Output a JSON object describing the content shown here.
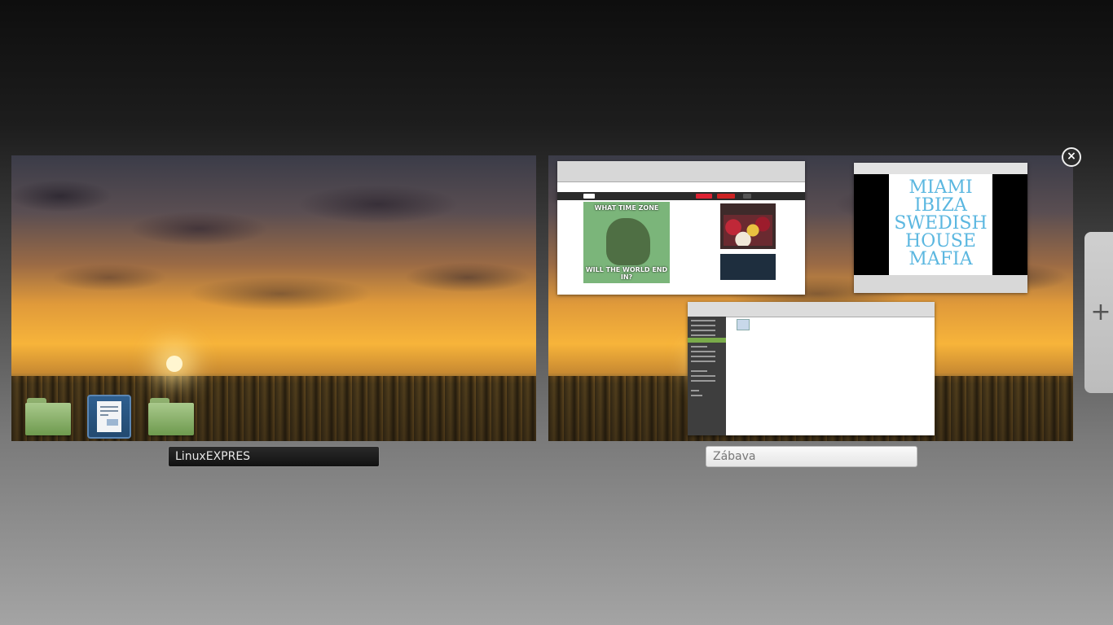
{
  "workspaces": [
    {
      "name": "LinuxEXPRES",
      "active": true,
      "desktop_icons": [
        "folder-icon",
        "document-icon",
        "folder-icon"
      ]
    },
    {
      "name": "Zábava",
      "active": false,
      "windows": {
        "browser": {
          "meme_top": "WHAT TIME ZONE",
          "meme_bottom": "WILL THE WORLD END IN?"
        },
        "music_player": {
          "album_lines": [
            "MIAMI",
            "IBIZA",
            "SWEDISH",
            "HOUSE",
            "MAFIA"
          ]
        },
        "file_manager": {}
      }
    }
  ],
  "controls": {
    "close_icon": "close-icon",
    "close_glyph": "×",
    "add_icon": "plus-icon",
    "add_glyph": "+"
  },
  "colors": {
    "active_label_bg": "#111111",
    "inactive_label_bg": "#eeeeee",
    "file_selection": "#7aab4a"
  }
}
